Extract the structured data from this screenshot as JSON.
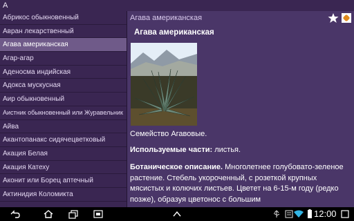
{
  "titlebar": {
    "letter": "А"
  },
  "sidebar": {
    "items": [
      "Абрикос обыкновенный",
      "Авран лекарственный",
      "Агава американская",
      "Агар-агар",
      "Аденосма индийская",
      "Адокса мускусная",
      "Аир обыкновенный",
      "Аистник обыкновенный или Журавельник",
      "Айва",
      "Акантопанакс сидячецветковый",
      "Акация Белая",
      "Акация Катеху",
      "Аконит или Борец аптечный",
      "Актинидия Коломикта"
    ],
    "active_index": 2
  },
  "content": {
    "header": "Агава американская",
    "title": "Агава американская",
    "family": "Семейство Агавовые.",
    "parts_label": "Используемые части:",
    "parts_value": " листья.",
    "desc_label": "Ботаническое описание.",
    "desc_value": "  Многолетнее голубовато-зеленое растение. Стебель укороченный, с розеткой крупных мясистых и колючих листьев. Цветет на 6-15-м году (редко позже), образуя цветонос с большим",
    "icons": [
      "star-icon",
      "fullscreen-icon"
    ]
  },
  "navbar": {
    "icons": [
      "back-icon",
      "home-icon",
      "recent-apps-icon",
      "screenshot-icon",
      "up-arrow-icon",
      "usb-icon",
      "notification-icon",
      "wifi-icon",
      "battery-icon"
    ],
    "time": "12:00"
  }
}
